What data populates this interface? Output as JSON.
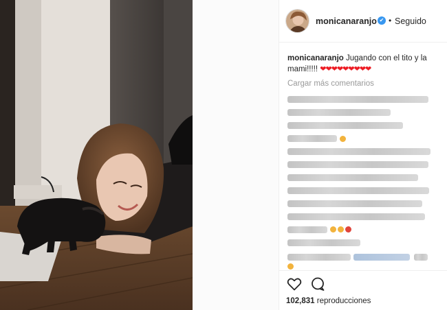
{
  "post": {
    "username": "monicanaranjo",
    "verified_mark": "✔",
    "separator": "•",
    "follow_status": "Seguido",
    "caption_user": "monicanaranjo",
    "caption_text": "Jugando con el tito y la mami!!!!!",
    "caption_hearts": "❤❤❤❤❤❤❤❤❤",
    "load_more": "Cargar más comentarios",
    "views_count": "102,831",
    "views_label": " reproducciones"
  },
  "icons": {
    "like": "heart-outline-icon",
    "comment": "comment-bubble-icon",
    "verified": "verified-badge-icon"
  },
  "colors": {
    "verified_blue": "#3897f0",
    "heart_red": "#ed1c24",
    "muted_text": "#999999",
    "divider": "#efefef"
  }
}
